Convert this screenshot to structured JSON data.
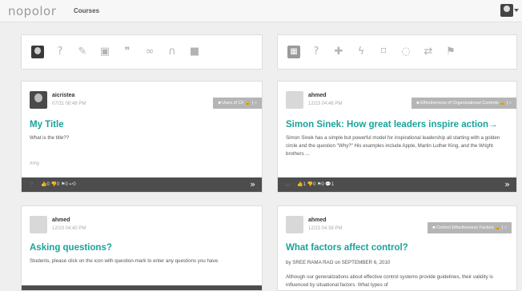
{
  "header": {
    "logo": "nopolor",
    "nav_courses": "Courses"
  },
  "toolbar_left": {
    "icons": [
      "avatar",
      "question-icon",
      "pencil-icon",
      "image-icon",
      "quote-icon",
      "link-icon",
      "headphones-icon",
      "video-icon"
    ],
    "glyphs": {
      "question": "?",
      "pencil": "✎",
      "image": "▣",
      "quote": "❞",
      "link": "∞",
      "headphones": "∩",
      "video": "■"
    }
  },
  "toolbar_right": {
    "icons": [
      "grid-icon",
      "question-icon",
      "puzzle-icon",
      "lightning-icon",
      "bookmark-icon",
      "chat-icon",
      "retweet-icon",
      "flag-icon"
    ],
    "glyphs": {
      "grid": "▦",
      "question": "?",
      "puzzle": "✚",
      "lightning": "ϟ",
      "bookmark": "⌑",
      "chat": "◌",
      "retweet": "⇄",
      "flag": "⚑"
    }
  },
  "cards": [
    {
      "author": "aicristea",
      "date": "07/31 08:48 PM",
      "tag": "■ Uses of CF  🔒 | ○",
      "title": "My Title",
      "body": "What is the title??",
      "hashtag": "#my",
      "stats": "👍0  👎0  ⚑0  ↩0",
      "arrow": "»"
    },
    {
      "author": "ahmed",
      "date": "12/23 04:46 PM",
      "tag": "■ Effectiveness of Organizational Controls  🔒 | ○",
      "title": "Simon Sinek: How great leaders inspire action→",
      "body": "Simon Sinek has a simple but powerful model for inspirational leadership all starting with a golden circle and the question \"Why?\" His examples include Apple, Martin Luther King, and the Wright brothers ...",
      "stats": "👍1  👎0  ⚑0  💬1",
      "arrow": "»"
    },
    {
      "author": "ahmed",
      "date": "12/23 04:40 PM",
      "title": "Asking questions?",
      "body": "Students, please click on the icon with question-mark to enter any questions you have."
    },
    {
      "author": "ahmed",
      "date": "12/23 04:38 PM",
      "tag": "■ Control Effectiveness Factors  🔒 | ○",
      "title": "What factors affect control?",
      "byline": "by SREE RAMA RAO on SEPTEMBER 6, 2010",
      "body": "Although our generalizations about effective control systems provide guidelines, their validity is influenced by situational factors. What types of"
    }
  ]
}
